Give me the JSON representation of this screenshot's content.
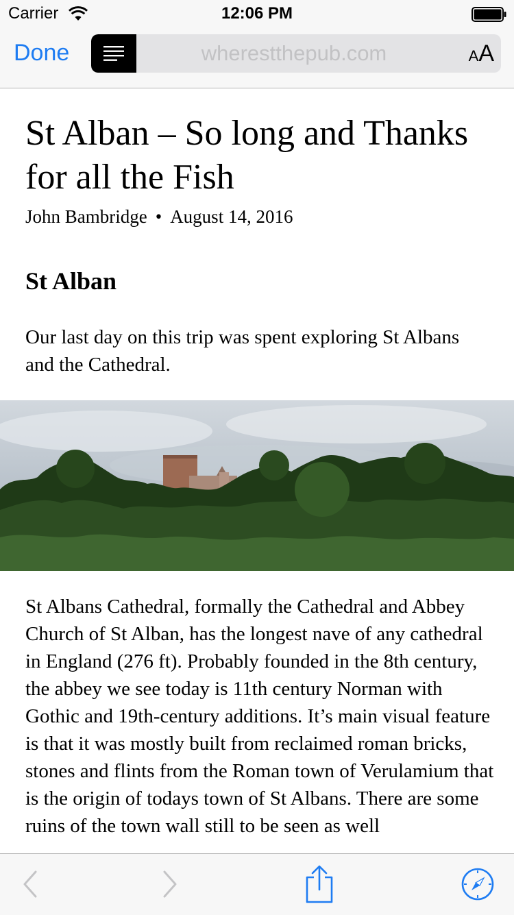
{
  "status_bar": {
    "carrier": "Carrier",
    "time": "12:06 PM",
    "icons": [
      "wifi-icon",
      "battery-icon"
    ]
  },
  "nav_bar": {
    "done_label": "Done",
    "address": "wherestthepub.com",
    "text_size_small": "A",
    "text_size_large": "A",
    "icons": [
      "reader-view-icon"
    ],
    "accent_color": "#1e7cf2"
  },
  "article": {
    "title": "St Alban – So long and Thanks for all the Fish",
    "author": "John Bambridge",
    "separator": "•",
    "date": "August 14, 2016",
    "heading": "St Alban",
    "intro": "Our last day on this trip was spent exploring St Albans and the Cathedral.",
    "body": "St Albans Cathedral, formally the Cathedral and Abbey Church of St Alban, has the longest nave of any cathedral in England (276 ft). Probably founded in the 8th century, the abbey we see today is 11th century Norman with Gothic and 19th-century additions.  It’s main visual feature is that it was mostly built from reclaimed roman bricks, stones and flints from the Roman town of Verulamium  that is the origin of todays town of St Albans. There are some ruins of the town wall still to be seen as well"
  },
  "toolbar": {
    "icons": [
      "back-icon",
      "forward-icon",
      "share-icon",
      "compass-icon"
    ],
    "disabled_color": "#c4c4c6"
  }
}
